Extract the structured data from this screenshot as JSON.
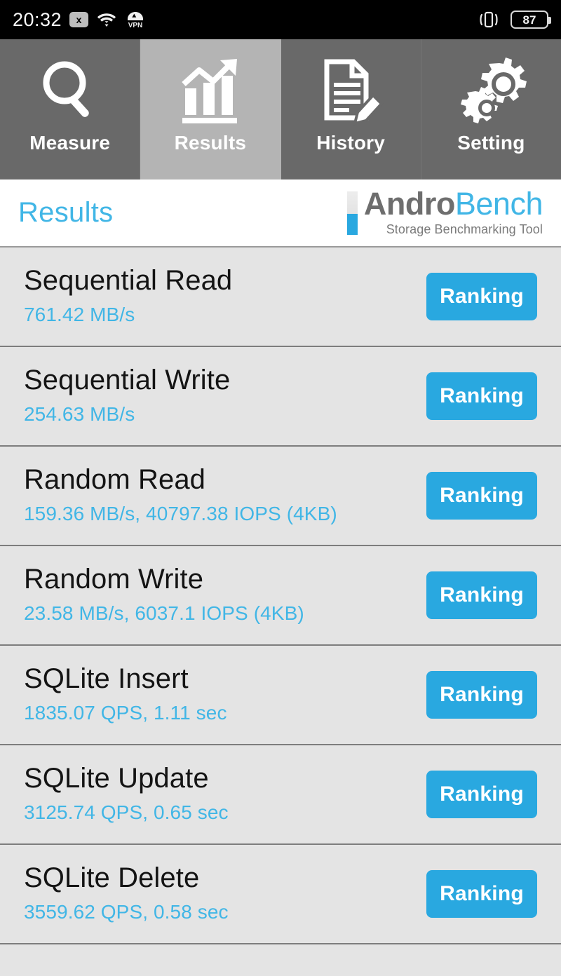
{
  "statusbar": {
    "time": "20:32",
    "icons": {
      "x_badge": "x",
      "wifi": "wifi-icon",
      "vpn": "VPN",
      "vibrate": "vibrate-icon"
    },
    "battery_level": "87"
  },
  "tabs": [
    {
      "label": "Measure",
      "icon": "magnifier-icon",
      "active": false
    },
    {
      "label": "Results",
      "icon": "bar-chart-arrow-icon",
      "active": true
    },
    {
      "label": "History",
      "icon": "document-pencil-icon",
      "active": false
    },
    {
      "label": "Setting",
      "icon": "gears-icon",
      "active": false
    }
  ],
  "header": {
    "title": "Results",
    "brand_primary": "Andro",
    "brand_secondary": "Bench",
    "brand_tagline": "Storage Benchmarking Tool"
  },
  "results": {
    "ranking_label": "Ranking",
    "rows": [
      {
        "title": "Sequential Read",
        "value": "761.42 MB/s"
      },
      {
        "title": "Sequential Write",
        "value": "254.63 MB/s"
      },
      {
        "title": "Random Read",
        "value": "159.36 MB/s, 40797.38 IOPS (4KB)"
      },
      {
        "title": "Random Write",
        "value": "23.58 MB/s, 6037.1 IOPS (4KB)"
      },
      {
        "title": "SQLite Insert",
        "value": "1835.07 QPS, 1.11 sec"
      },
      {
        "title": "SQLite Update",
        "value": "3125.74 QPS, 0.65 sec"
      },
      {
        "title": "SQLite Delete",
        "value": "3559.62 QPS, 0.58 sec"
      }
    ]
  },
  "colors": {
    "accent_blue": "#29a8e0",
    "title_blue": "#41b6e6",
    "tab_inactive": "#696969",
    "tab_active": "#b4b4b4",
    "list_bg": "#e4e4e4"
  }
}
